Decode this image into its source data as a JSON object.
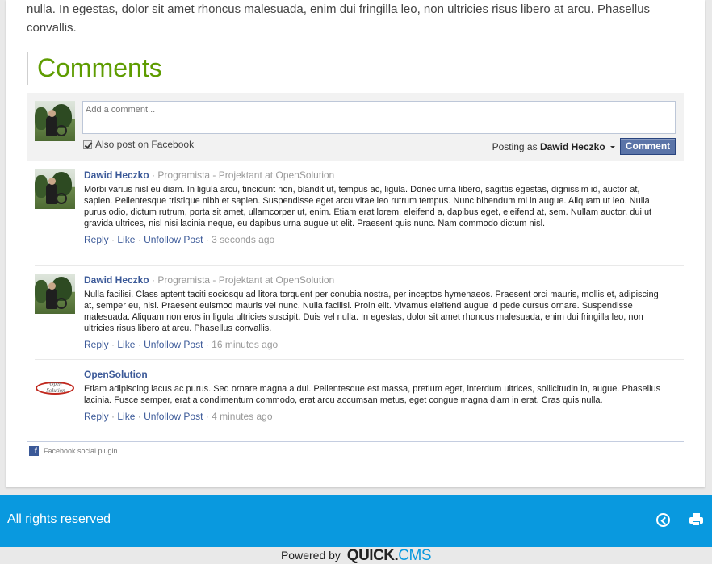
{
  "article": {
    "intro_line1": "nulla. In egestas, dolor sit amet rhoncus malesuada, enim dui fringilla leo, non ultricies risus libero at arcu. Phasellus",
    "intro_line2": "convallis."
  },
  "comments_section": {
    "heading": "Comments",
    "compose": {
      "placeholder": "Add a comment...",
      "also_post_label": "Also post on Facebook",
      "posting_as_prefix": "Posting as",
      "posting_as_user": "Dawid Heczko",
      "submit_label": "Comment"
    },
    "items": [
      {
        "author": "Dawid Heczko",
        "separator": "·",
        "role": "Programista - Projektant",
        "at": "at",
        "company": "OpenSolution",
        "text": "Morbi varius nisl eu diam. In ligula arcu, tincidunt non, blandit ut, tempus ac, ligula. Donec urna libero, sagittis egestas, dignissim id, auctor at, sapien. Pellentesque tristique nibh et sapien. Suspendisse eget arcu vitae leo rutrum tempus. Nunc bibendum mi in augue. Aliquam ut leo. Nulla purus odio, dictum rutrum, porta sit amet, ullamcorper ut, enim. Etiam erat lorem, eleifend a, dapibus eget, eleifend at, sem. Nullam auctor, dui ut gravida ultrices, nisl nisi lacinia neque, eu dapibus urna augue ut elit. Praesent quis nunc. Nam commodo dictum nisl.",
        "reply": "Reply",
        "like": "Like",
        "unfollow": "Unfollow Post",
        "time": "3 seconds ago"
      },
      {
        "author": "Dawid Heczko",
        "separator": "·",
        "role": "Programista - Projektant",
        "at": "at",
        "company": "OpenSolution",
        "text": "Nulla facilisi. Class aptent taciti sociosqu ad litora torquent per conubia nostra, per inceptos hymenaeos. Praesent orci mauris, mollis et, adipiscing at, semper eu, nisi. Praesent euismod mauris vel nunc. Nulla facilisi. Proin elit. Vivamus eleifend augue id pede cursus ornare. Suspendisse malesuada. Aliquam non eros in ligula ultricies suscipit. Duis vel nulla. In egestas, dolor sit amet rhoncus malesuada, enim dui fringilla leo, non ultricies risus libero at arcu. Phasellus convallis.",
        "reply": "Reply",
        "like": "Like",
        "unfollow": "Unfollow Post",
        "time": "16 minutes ago"
      },
      {
        "author": "OpenSolution",
        "text": "Etiam adipiscing lacus ac purus. Sed ornare magna a dui. Pellentesque est massa, pretium eget, interdum ultrices, sollicitudin in, augue. Phasellus lacinia. Fusce semper, erat a condimentum commodo, erat arcu accumsan metus, eget congue magna diam in erat. Cras quis nulla.",
        "reply": "Reply",
        "like": "Like",
        "unfollow": "Unfollow Post",
        "time": "4 minutes ago",
        "logo_text_line1": "Open",
        "logo_text_line2": "Solution"
      }
    ],
    "dot": "·",
    "plugin_label": "Facebook social plugin",
    "fb_glyph": "f"
  },
  "footer": {
    "copyright": "All rights reserved",
    "powered_prefix": "Powered by",
    "brand_quick": "QUICK.",
    "brand_cms": "CMS"
  },
  "icons": {
    "back": "back-arrow-circle-icon",
    "print": "printer-icon",
    "facebook": "facebook-icon"
  },
  "colors": {
    "accent_green": "#5e9c00",
    "facebook_blue": "#3b5998",
    "footer_blue": "#0999df"
  }
}
